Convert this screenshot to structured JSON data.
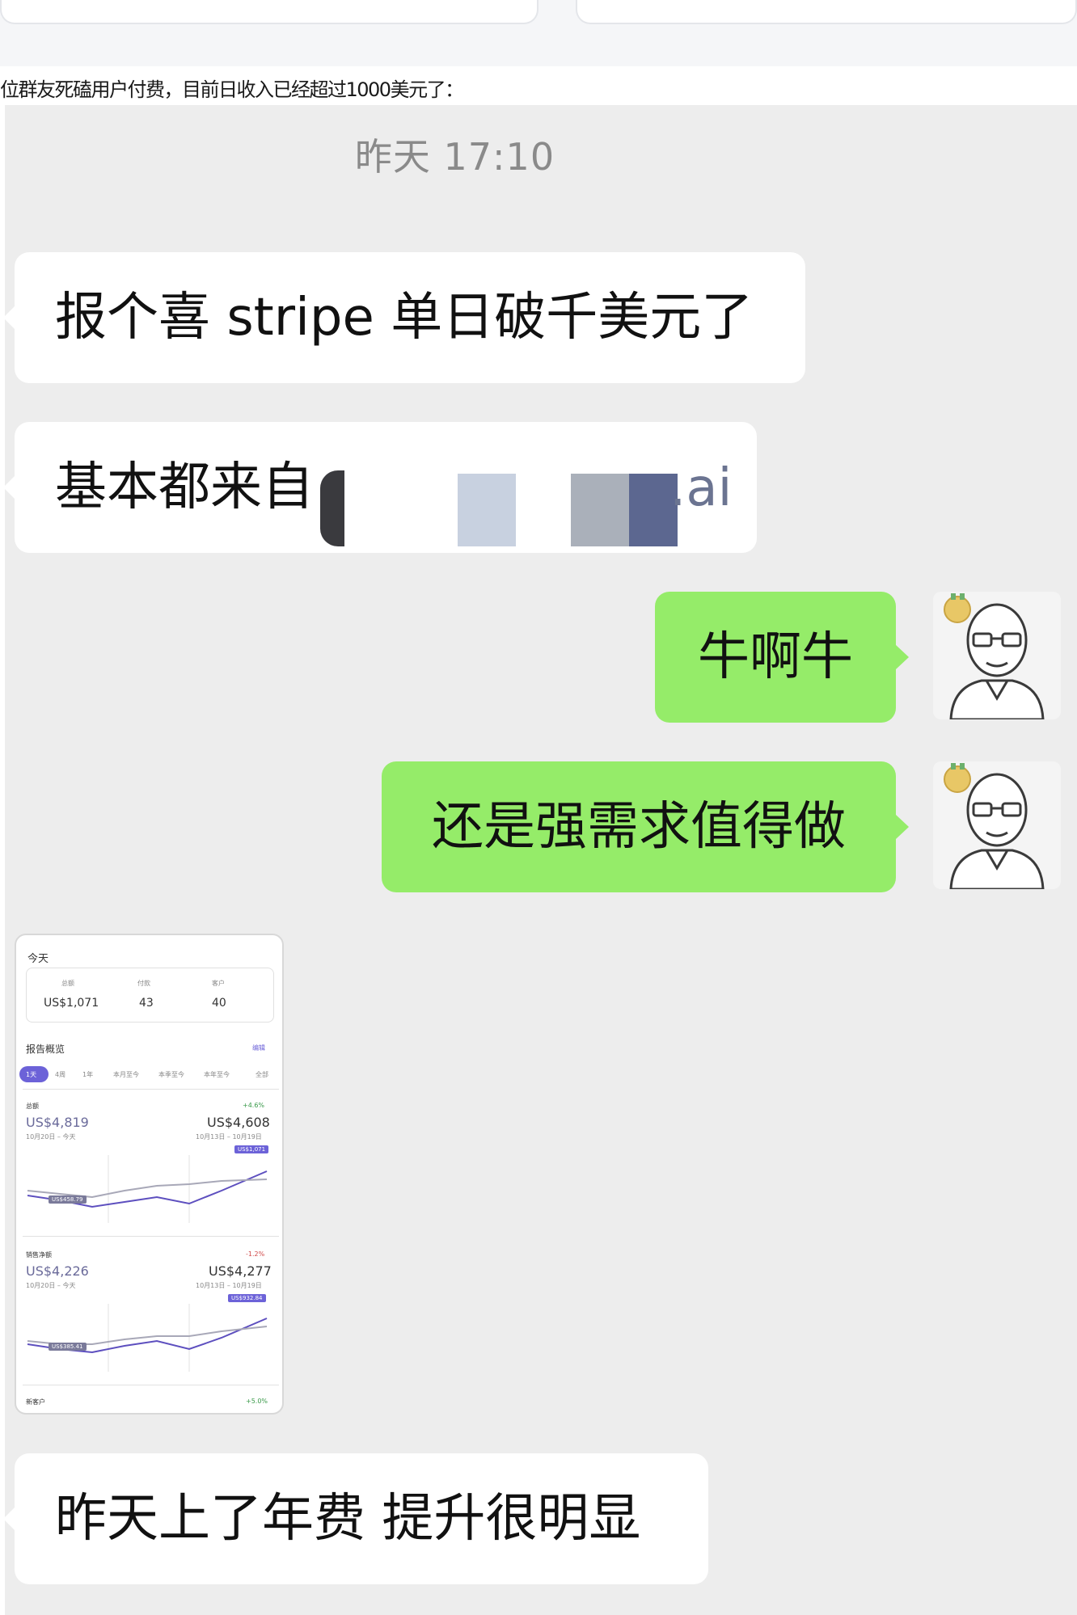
{
  "article": {
    "caption": "位群友死磕用户付费，目前日收入已经超过1000美元了："
  },
  "chat": {
    "timestamp": "昨天 17:10",
    "messages": [
      {
        "side": "left",
        "text": "报个喜 stripe 单日破千美元了"
      },
      {
        "side": "left",
        "text": "基本都来自",
        "suffix": ".ai",
        "redacted": true
      },
      {
        "side": "right",
        "text": "牛啊牛"
      },
      {
        "side": "right",
        "text": "还是强需求值得做"
      },
      {
        "side": "left",
        "text": "昨天上了年费 提升很明显"
      }
    ],
    "colors": {
      "background": "#ededed",
      "incoming": "#ffffff",
      "outgoing": "#95ec69"
    }
  },
  "stripe_shot": {
    "today_label": "今天",
    "stats": [
      {
        "label": "总额",
        "value": "US$1,071"
      },
      {
        "label": "付款",
        "value": "43"
      },
      {
        "label": "客户",
        "value": "40"
      }
    ],
    "report_title": "报告概览",
    "edit_label": "编辑",
    "ranges": [
      "1天",
      "4周",
      "1年",
      "本月至今",
      "本季至今",
      "本年至今",
      "全部"
    ],
    "gross": {
      "label": "总额",
      "change": "+4.6%",
      "current": "US$4,819",
      "current_period": "10月20日 – 今天",
      "previous": "US$4,608",
      "previous_period": "10月13日 – 10月19日",
      "tag_high": "US$1,071",
      "tag_low": "US$458.79"
    },
    "net": {
      "label": "销售净额",
      "change": "-1.2%",
      "current": "US$4,226",
      "current_period": "10月20日 – 今天",
      "previous": "US$4,277",
      "previous_period": "10月13日 – 10月19日",
      "tag_high": "US$932.84",
      "tag_low": "US$385.41"
    },
    "new_customers": {
      "label": "新客户",
      "change": "+5.0%"
    }
  }
}
